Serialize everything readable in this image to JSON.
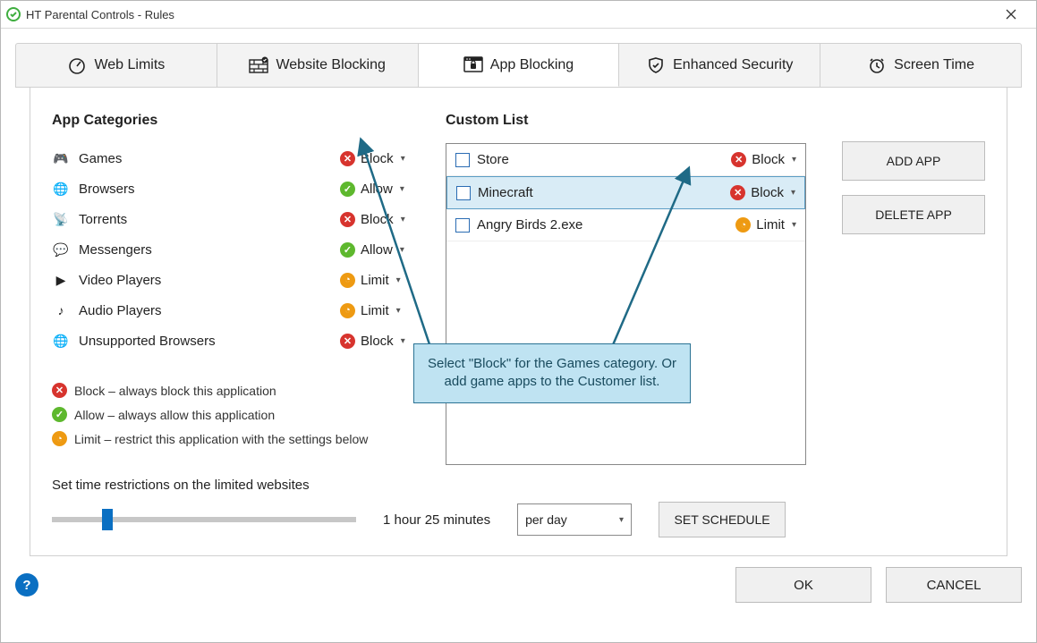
{
  "window": {
    "title": "HT Parental Controls - Rules"
  },
  "tabs": [
    {
      "label": "Web Limits"
    },
    {
      "label": "Website Blocking"
    },
    {
      "label": "App Blocking"
    },
    {
      "label": "Enhanced Security"
    },
    {
      "label": "Screen Time"
    }
  ],
  "active_tab": "App Blocking",
  "categories": {
    "title": "App Categories",
    "items": [
      {
        "name": "Games",
        "action": "Block"
      },
      {
        "name": "Browsers",
        "action": "Allow"
      },
      {
        "name": "Torrents",
        "action": "Block"
      },
      {
        "name": "Messengers",
        "action": "Allow"
      },
      {
        "name": "Video Players",
        "action": "Limit"
      },
      {
        "name": "Audio Players",
        "action": "Limit"
      },
      {
        "name": "Unsupported Browsers",
        "action": "Block"
      }
    ]
  },
  "legend": {
    "block": "Block – always block this application",
    "allow": "Allow – always allow this application",
    "limit": "Limit – restrict this application with the settings below"
  },
  "custom_list": {
    "title": "Custom List",
    "items": [
      {
        "name": "Store",
        "action": "Block",
        "selected": false
      },
      {
        "name": "Minecraft",
        "action": "Block",
        "selected": true
      },
      {
        "name": "Angry Birds 2.exe",
        "action": "Limit",
        "selected": false
      }
    ]
  },
  "buttons": {
    "add_app": "ADD APP",
    "delete_app": "DELETE APP",
    "set_schedule": "SET SCHEDULE",
    "ok": "OK",
    "cancel": "CANCEL"
  },
  "time": {
    "label": "Set time restrictions on the limited websites",
    "value_text": "1 hour 25 minutes",
    "per": "per day"
  },
  "callout": {
    "text": "Select \"Block\" for the Games category. Or add game apps to the Customer list."
  }
}
